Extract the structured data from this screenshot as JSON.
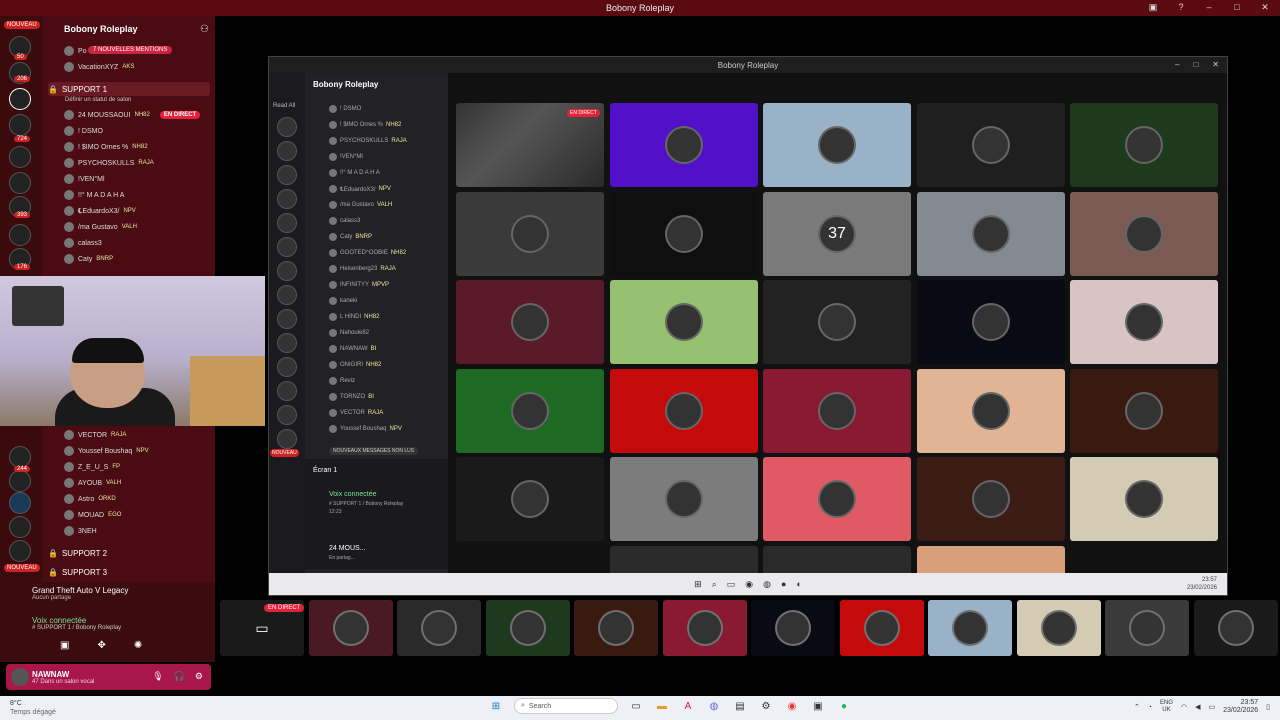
{
  "window": {
    "title": "Bobony Roleplay"
  },
  "discord": {
    "server_name": "Bobony Roleplay",
    "new_badge": "NOUVEAU",
    "rail_badges": [
      "50",
      "206",
      "724",
      "393",
      "176",
      "244"
    ],
    "mentions_badge": "7 NOUVELLES MENTIONS",
    "top_users": [
      {
        "name": "Po",
        "tag": ""
      },
      {
        "name": "VacationXYZ",
        "tag": "AKS"
      }
    ],
    "support1": {
      "label": "SUPPORT 1",
      "status": "Définir un statut de salon"
    },
    "members_a": [
      {
        "name": "24 MOUSSAOUI",
        "tag": "NH82",
        "live": "EN DIRECT"
      },
      {
        "name": "! DSMO",
        "tag": ""
      },
      {
        "name": "! $IMO Ornes %",
        "tag": "NH82"
      },
      {
        "name": "PSYCHOSKULLS",
        "tag": "RAJA"
      },
      {
        "name": "!VEN°Ml",
        "tag": ""
      },
      {
        "name": "!!° M A D A H A",
        "tag": ""
      },
      {
        "name": "℄EduardoX3/",
        "tag": "NPV"
      },
      {
        "name": "/ma Gustavo",
        "tag": "VALH"
      },
      {
        "name": "calass3",
        "tag": ""
      },
      {
        "name": "Caty",
        "tag": "BNRP"
      }
    ],
    "members_b": [
      {
        "name": "VECTOR",
        "tag": "RAJA"
      },
      {
        "name": "Youssef Boushaq",
        "tag": "NPV"
      },
      {
        "name": "Z_E_U_S",
        "tag": "FP"
      },
      {
        "name": "AYOUB",
        "tag": "VALH"
      },
      {
        "name": "Astro",
        "tag": "ORKD"
      },
      {
        "name": "MOUAD",
        "tag": "EGO"
      },
      {
        "name": "3NEH",
        "tag": ""
      }
    ],
    "support2": "SUPPORT 2",
    "support3": "SUPPORT 3",
    "activity": {
      "game": "Grand Theft Auto V Legacy",
      "sub": "Aucun partage"
    },
    "voice": {
      "status": "Voix connectée",
      "channel": "# SUPPORT 1 / Bobony Roleplay"
    },
    "user": {
      "name": "NAWNAW",
      "status": "47 Dans un salon vocal"
    }
  },
  "inner": {
    "title": "Bobony Roleplay",
    "server_name": "Bobony Roleplay",
    "read_all": "Read All",
    "members": [
      {
        "name": "! DSMO",
        "tag": ""
      },
      {
        "name": "! $IMO Ornes %",
        "tag": "NH82"
      },
      {
        "name": "PSYCHOSKULLS",
        "tag": "RAJA"
      },
      {
        "name": "!VEN°Ml",
        "tag": ""
      },
      {
        "name": "!!° M A D A H A",
        "tag": ""
      },
      {
        "name": "℄EduardoX3/",
        "tag": "NPV"
      },
      {
        "name": "/ma Gustavo",
        "tag": "VALH"
      },
      {
        "name": "calass3",
        "tag": ""
      },
      {
        "name": "Caty",
        "tag": "BNRP"
      },
      {
        "name": "GOOTED^OOBIE",
        "tag": "NH82"
      },
      {
        "name": "Heisenberg23",
        "tag": "RAJA"
      },
      {
        "name": "INFINITYY",
        "tag": "MPVP"
      },
      {
        "name": "kaneki",
        "tag": ""
      },
      {
        "name": "L HINDI",
        "tag": "NH82"
      },
      {
        "name": "Nahoule82",
        "tag": ""
      },
      {
        "name": "NAWNAW",
        "tag": "BI"
      },
      {
        "name": "ONIGIRI",
        "tag": "NH82"
      },
      {
        "name": "Reviz",
        "tag": ""
      },
      {
        "name": "TORNZO",
        "tag": "BI"
      },
      {
        "name": "VECTOR",
        "tag": "RAJA"
      },
      {
        "name": "Youssef Boushaq",
        "tag": "NPV"
      }
    ],
    "new_messages": "NOUVEAUX MESSAGES NON LUS",
    "nouveau": "NOUVEAU",
    "screen_label": "Écran 1",
    "voice_status": "Voix connectée",
    "voice_channel": "# SUPPORT 1 / Bobony Roleplay",
    "voice_time": "12:23",
    "user_name": "24 MOUS...",
    "user_status": "En partag...",
    "live_tag": "EN DIRECT",
    "tile_number": "37",
    "clock_time": "23:57",
    "clock_date": "23/02/2026",
    "lang": "ENG"
  },
  "tiles": [
    {
      "color": "#2a2a2a"
    },
    {
      "color": "#5210c8"
    },
    {
      "color": "#9ab2c8"
    },
    {
      "color": "#1f1f1f"
    },
    {
      "color": "#1d3a1d"
    },
    {
      "color": "#3a3a3a"
    },
    {
      "color": "#0f0f0f"
    },
    {
      "color": "#7a7a7a"
    },
    {
      "color": "#848a92"
    },
    {
      "color": "#7a5a52"
    },
    {
      "color": "#5a1a2a"
    },
    {
      "color": "#94c070"
    },
    {
      "color": "#222"
    },
    {
      "color": "#0a0a14"
    },
    {
      "color": "#d8c4c4"
    },
    {
      "color": "#1e6a24"
    },
    {
      "color": "#c40a0a"
    },
    {
      "color": "#8a1a32"
    },
    {
      "color": "#e2b496"
    },
    {
      "color": "#3a1a10"
    },
    {
      "color": "#1a1a1a"
    },
    {
      "color": "#7c7c7c"
    },
    {
      "color": "#e05a66"
    },
    {
      "color": "#3c1c14"
    },
    {
      "color": "#d4cbb4"
    }
  ],
  "strip": {
    "live": "EN DIRECT",
    "thumbs": [
      {
        "color": "#1a1a1a"
      },
      {
        "color": "#4a1a24"
      },
      {
        "color": "#2a2a2a"
      },
      {
        "color": "#1e3a1e"
      },
      {
        "color": "#3a1a10"
      },
      {
        "color": "#8a1a32"
      },
      {
        "color": "#0a0a14"
      },
      {
        "color": "#c40a0a"
      },
      {
        "color": "#9ab2c8"
      },
      {
        "color": "#d4cbb4"
      },
      {
        "color": "#3a3a3a"
      },
      {
        "color": "#1a1a1a"
      }
    ]
  },
  "taskbar": {
    "temp": "8°C",
    "weather": "Temps dégagé",
    "search": "Search",
    "lang1": "ENG",
    "lang2": "UK",
    "time": "23:57",
    "date": "23/02/2026"
  }
}
